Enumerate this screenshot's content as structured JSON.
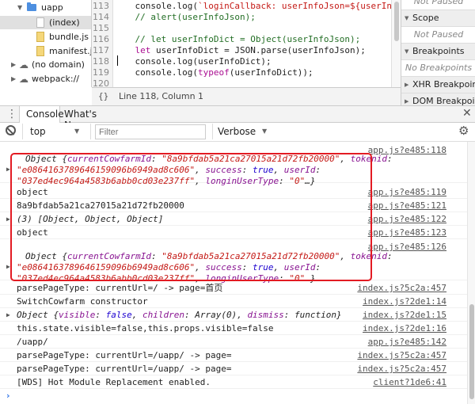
{
  "file_tree": {
    "items": [
      {
        "label": "uapp",
        "kind": "folder"
      },
      {
        "label": "(index)",
        "kind": "file"
      },
      {
        "label": "bundle.js",
        "kind": "file"
      },
      {
        "label": "manifest.json",
        "kind": "file"
      },
      {
        "label": "(no domain)",
        "kind": "cloud"
      },
      {
        "label": "webpack://",
        "kind": "cloud"
      }
    ]
  },
  "editor": {
    "line_numbers": [
      "113",
      "114",
      "115",
      "116",
      "117",
      "118",
      "119",
      "120"
    ],
    "status": "Line 118, Column 1",
    "pretty_print": "{}"
  },
  "right_panel": {
    "items": [
      {
        "label": "Not Paused",
        "kind": "italic"
      },
      {
        "label": "Scope",
        "kind": "header"
      },
      {
        "label": "Not Paused",
        "kind": "italic"
      },
      {
        "label": "Breakpoints",
        "kind": "header"
      },
      {
        "label": "No Breakpoints",
        "kind": "italic"
      },
      {
        "label": "XHR Breakpoints",
        "kind": "header"
      },
      {
        "label": "DOM Breakpoints",
        "kind": "header"
      }
    ]
  },
  "tabs": {
    "console": "Console",
    "whats_new": "What's New"
  },
  "filterbar": {
    "context": "top",
    "filter_placeholder": "Filter",
    "level": "Verbose"
  },
  "console": {
    "sources": [
      "app.js?e485:118",
      "app.js?e485:119",
      "app.js?e485:121",
      "app.js?e485:122",
      "app.js?e485:123",
      "app.js?e485:126",
      "index.js?5c2a:457",
      "index.js?2de1:14",
      "index.js?2de1:15",
      "index.js?2de1:16",
      "app.js?e485:142",
      "index.js?5c2a:457",
      "index.js?5c2a:457",
      "client?1de6:41"
    ],
    "obj1": {
      "head": "Object {",
      "k1": "currentCowfarmId",
      "v1": "\"8a9bfdab5a21ca27015a21d72fb20000\"",
      "k2": "tokenid",
      "v2a": "\"e086416378964615909 6b6949ad8c606\"",
      "v2": "\"e0864163789646159096b6949ad8c606\"",
      "k3": "success",
      "v3": "true",
      "k4": "userId",
      "v4": "\"037ed4ec964a4583b6abb0cd03e237ff\"",
      "k5": "longinUserType",
      "v5": "\"0\"",
      "tail": "…}"
    },
    "line_object": "object",
    "line_id": "8a9bfdab5a21ca27015a21d72fb20000",
    "line_array": "(3) [Object, Object, Object]",
    "line_object2": "object",
    "line_parse1": "parsePageType: currentUrl=/ -> page=首页",
    "line_switch": "SwitchCowfarm constructor",
    "obj2": {
      "head": "Object {",
      "k1": "visible",
      "v1": "false",
      "k2": "children",
      "v2": "Array(0)",
      "k3": "dismiss",
      "v3": "function",
      "tail": "}"
    },
    "line_state": "this.state.visible=false,this.props.visible=false",
    "line_uapp": "/uapp/",
    "line_parse2": "parsePageType: currentUrl=/uapp/ -> page=",
    "line_parse3": "parsePageType: currentUrl=/uapp/ -> page=",
    "line_wds": "[WDS] Hot Module Replacement enabled."
  },
  "colors": {
    "highlight": "#e31b23",
    "tab_active": "#3779e8"
  }
}
